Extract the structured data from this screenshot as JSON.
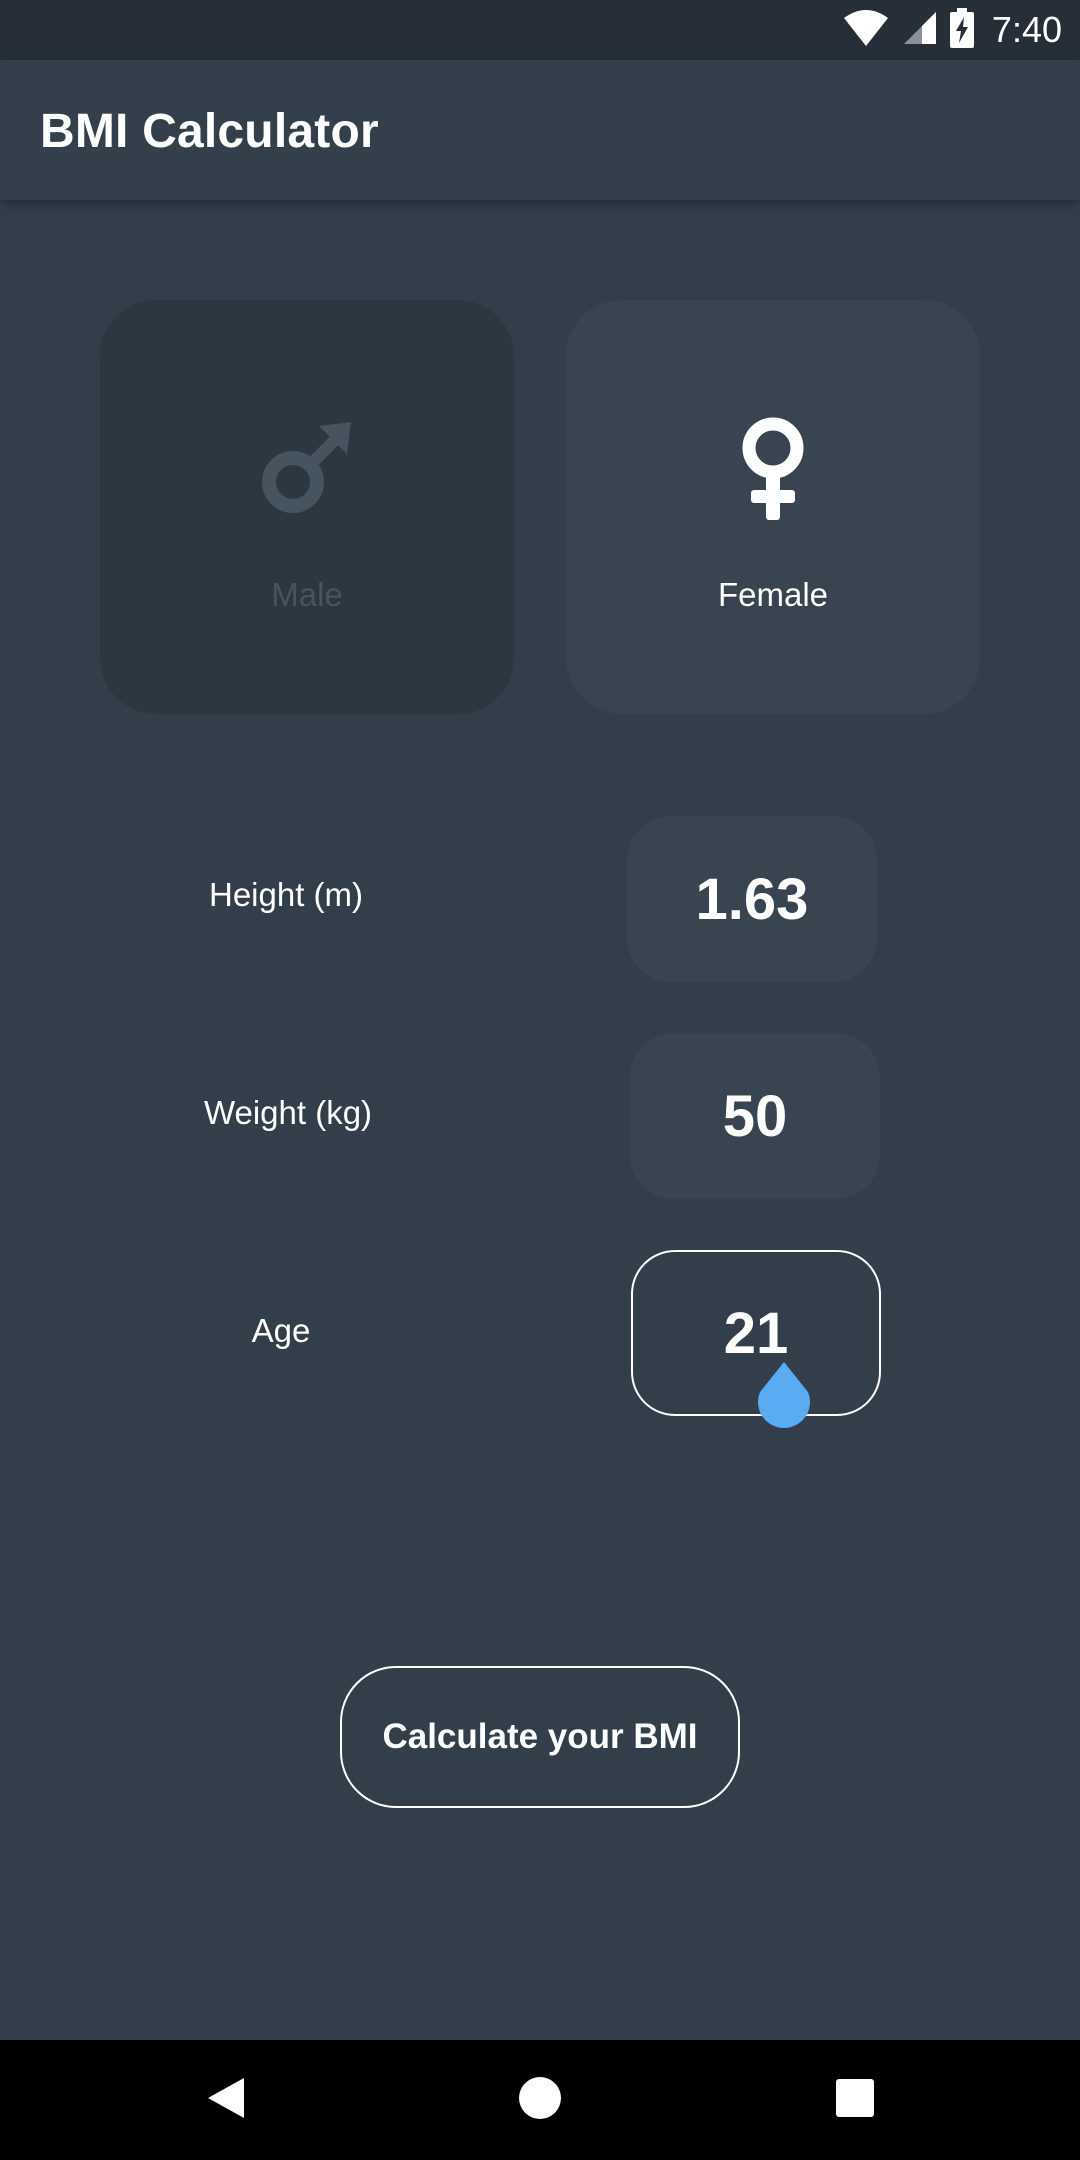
{
  "status_bar": {
    "time": "7:40",
    "icons": [
      "wifi-icon",
      "cell-signal-icon",
      "battery-charging-icon"
    ]
  },
  "app_bar": {
    "title": "BMI Calculator"
  },
  "gender": {
    "male_label": "Male",
    "female_label": "Female",
    "selected": "Female"
  },
  "form": {
    "height": {
      "label": "Height (m)",
      "value": "1.63"
    },
    "weight": {
      "label": "Weight (kg)",
      "value": "50"
    },
    "age": {
      "label": "Age",
      "value": "21"
    }
  },
  "calculate_button": {
    "label": "Calculate your BMI"
  },
  "nav_bar": {
    "buttons": [
      "back-icon",
      "home-icon",
      "recents-icon"
    ]
  },
  "colors": {
    "background": "#323e49",
    "app_bar": "#333f4a",
    "status_bar": "#262f37",
    "card_selected": "#38444f",
    "card_unselected": "#2c3740",
    "accent_cursor": "#5aabf4",
    "disabled_text": "#465460"
  }
}
